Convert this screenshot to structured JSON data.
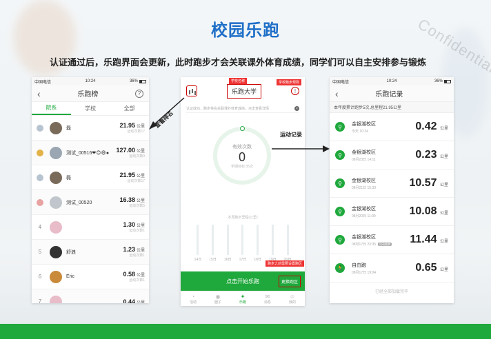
{
  "title": "校园乐跑",
  "subtitle": "认证通过后，乐跑界面会更新，此时跑步才会关联课外体育成绩，同学们可以自主安排参与锻炼",
  "watermark": "Confidential",
  "colors": {
    "brand_green": "#1fa83c",
    "title_blue": "#1f6fc8",
    "highlight_red": "#cc0000"
  },
  "annotations": {
    "view_rank": "查看排名",
    "exercise_record": "运动记录"
  },
  "status_bar": {
    "carrier": "中国电信",
    "time": "10:24",
    "battery": "36%"
  },
  "left_phone": {
    "title": "乐跑榜",
    "tabs": [
      "院系",
      "学校",
      "全部"
    ],
    "rows": [
      {
        "rank": "",
        "medal": "m1",
        "name": "磊",
        "dist": "21.95",
        "unit": "公里",
        "sub": "运动次数17",
        "avatar": "#7a6a5a"
      },
      {
        "rank": "",
        "medal": "m2",
        "name": "测试_00516❤😊😄●",
        "dist": "127.00",
        "unit": "公里",
        "sub": "运动次数9",
        "avatar": "#9aa7b2"
      },
      {
        "rank": "",
        "medal": "m1",
        "name": "磊",
        "dist": "21.95",
        "unit": "公里",
        "sub": "运动次数17",
        "avatar": "#7a6a5a"
      },
      {
        "rank": "",
        "medal": "m3",
        "name": "测试_00520",
        "dist": "16.38",
        "unit": "公里",
        "sub": "运动次数5",
        "avatar": "#c0c6cc"
      },
      {
        "rank": "4",
        "medal": "",
        "name": "",
        "dist": "1.30",
        "unit": "公里",
        "sub": "运动次数1",
        "avatar": "#e8bcc8"
      },
      {
        "rank": "5",
        "medal": "",
        "name": "舒浪",
        "dist": "1.23",
        "unit": "公里",
        "sub": "运动次数1",
        "avatar": "#333333"
      },
      {
        "rank": "6",
        "medal": "",
        "name": "Eric",
        "dist": "0.58",
        "unit": "公里",
        "sub": "运动次数1",
        "avatar": "#c98a3a"
      },
      {
        "rank": "7",
        "medal": "",
        "name": "",
        "dist": "0.44",
        "unit": "公里",
        "sub": "",
        "avatar": "#e8bcc8"
      }
    ]
  },
  "middle_phone": {
    "school": "乐跑大学",
    "tag_school_name": "学校名称",
    "tag_school_rules": "学校跑步规则",
    "notice": "认证成功，跑步将会关联课外体育成绩，点击查看详情",
    "ring_label": "有效次数",
    "ring_value": "0",
    "ring_target": "学期目标:35次",
    "weekly_title": "本周跑步里程(公里)",
    "days": [
      "14日",
      "15日",
      "16日",
      "17日",
      "18日",
      "19日",
      "20日"
    ],
    "warn_tag": "跑步之前需要设置跑区",
    "start_label": "点击开始乐跑",
    "update_zone": "更换跑区",
    "nav": [
      {
        "icon": "◔",
        "label": "活动"
      },
      {
        "icon": "◉",
        "label": "圈子"
      },
      {
        "icon": "✦",
        "label": "乐跑"
      },
      {
        "icon": "✉",
        "label": "消息"
      },
      {
        "icon": "☺",
        "label": "我的"
      }
    ]
  },
  "right_phone": {
    "title": "乐跑记录",
    "summary": "本年度累计跑步5次,总里程21.95公里",
    "records": [
      {
        "icon": "⚲",
        "title": "金银湖校区",
        "date": "今天 10:24",
        "dist": "0.42",
        "unit": "公里",
        "badge": ""
      },
      {
        "icon": "⚲",
        "title": "金银湖校区",
        "date": "08月23日 14:11",
        "dist": "0.23",
        "unit": "公里",
        "badge": ""
      },
      {
        "icon": "⚲",
        "title": "金银湖校区",
        "date": "08月21日 15:30",
        "dist": "10.57",
        "unit": "公里",
        "badge": ""
      },
      {
        "icon": "⚲",
        "title": "金银湖校区",
        "date": "08月20日 11:09",
        "dist": "10.08",
        "unit": "公里",
        "badge": ""
      },
      {
        "icon": "⚲",
        "title": "金银湖校区",
        "date": "08月17日 23:35",
        "dist": "11.44",
        "unit": "公里",
        "badge": "自动结束"
      },
      {
        "icon": "🏃",
        "title": "自由跑",
        "date": "08月17日 19:04",
        "dist": "0.65",
        "unit": "公里",
        "badge": ""
      }
    ],
    "footer": "已经全部加载完毕"
  }
}
